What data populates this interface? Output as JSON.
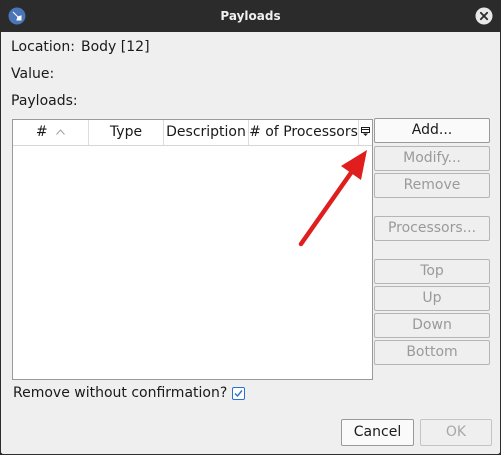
{
  "window": {
    "title": "Payloads",
    "close_icon": "close-icon",
    "app_icon": "app-icon"
  },
  "fields": {
    "location_label": "Location:",
    "location_value": "Body [12]",
    "value_label": "Value:",
    "payloads_label": "Payloads:"
  },
  "table": {
    "columns": [
      "#",
      "Type",
      "Description",
      "# of Processors"
    ],
    "sort_column": "#",
    "sort_direction": "ascending",
    "rows": []
  },
  "buttons": {
    "add": "Add...",
    "modify": "Modify...",
    "remove": "Remove",
    "processors": "Processors...",
    "top": "Top",
    "up": "Up",
    "down": "Down",
    "bottom": "Bottom"
  },
  "confirm": {
    "label": "Remove without confirmation?",
    "checked": true
  },
  "footer": {
    "cancel": "Cancel",
    "ok": "OK"
  },
  "colors": {
    "accent": "#2a6fd6",
    "annotation_arrow": "#e01e1e"
  }
}
